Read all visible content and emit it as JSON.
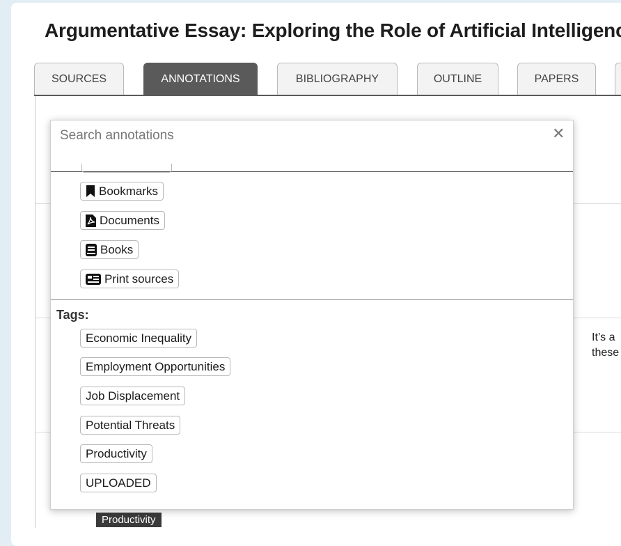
{
  "page": {
    "title": "Argumentative Essay: Exploring the Role of Artificial Intelligence"
  },
  "tabs": [
    {
      "label": "SOURCES",
      "active": false
    },
    {
      "label": "ANNOTATIONS",
      "active": true
    },
    {
      "label": "BIBLIOGRAPHY",
      "active": false
    },
    {
      "label": "OUTLINE",
      "active": false
    },
    {
      "label": "PAPERS",
      "active": false
    }
  ],
  "search": {
    "placeholder": "Search annotations",
    "value": "",
    "close_icon": "close-icon"
  },
  "source_filters": [
    {
      "label": "Bookmarks",
      "icon": "bookmark-icon"
    },
    {
      "label": "Documents",
      "icon": "pdf-document-icon"
    },
    {
      "label": "Books",
      "icon": "book-icon"
    },
    {
      "label": "Print sources",
      "icon": "newspaper-icon"
    }
  ],
  "tags": {
    "heading": "Tags:",
    "items": [
      "Economic Inequality",
      "Employment Opportunities",
      "Job Displacement",
      "Potential Threats",
      "Productivity",
      "UPLOADED"
    ]
  },
  "background": {
    "annotation_snippet_line1": "It’s a",
    "annotation_snippet_line2": "these",
    "tag_badge": "Productivity"
  },
  "colors": {
    "page_bg": "#e3eef4",
    "active_tab": "#5a5a5a",
    "tag_badge_bg": "#3a3a3a"
  }
}
